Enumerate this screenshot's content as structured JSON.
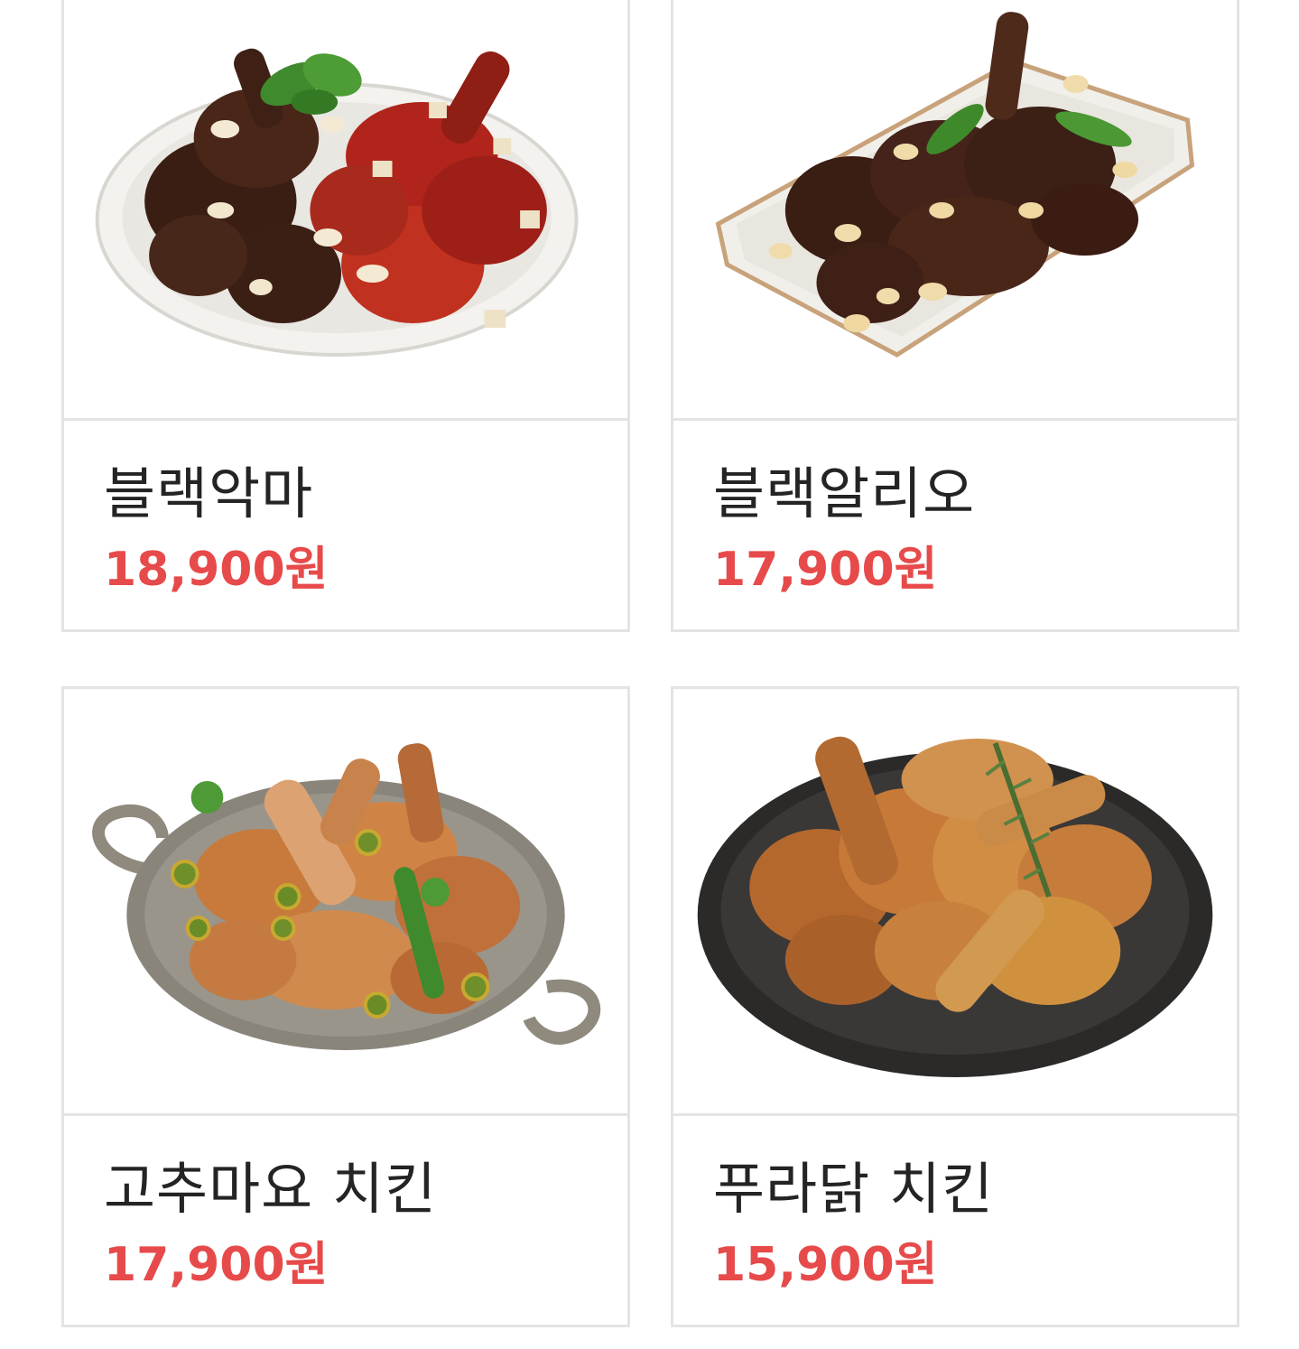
{
  "menu": {
    "items": [
      {
        "name": "블랙악마",
        "price": "18,900원",
        "image": "black-devil-chicken-image"
      },
      {
        "name": "블랙알리오",
        "price": "17,900원",
        "image": "black-alio-chicken-image"
      },
      {
        "name": "고추마요 치킨",
        "price": "17,900원",
        "image": "gochu-mayo-chicken-image"
      },
      {
        "name": "푸라닭 치킨",
        "price": "15,900원",
        "image": "puradak-chicken-image"
      }
    ]
  },
  "colors": {
    "price": "#e74a4a",
    "name": "#242424",
    "border": "#e4e4e4"
  }
}
